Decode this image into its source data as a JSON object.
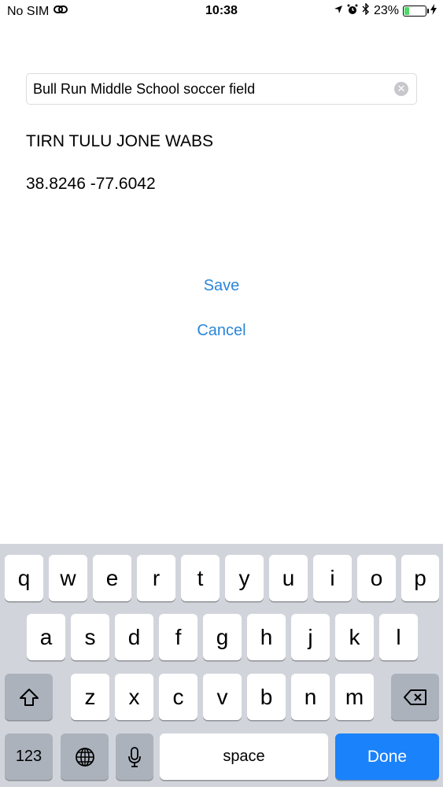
{
  "status_bar": {
    "carrier": "No SIM",
    "time": "10:38",
    "battery_percent": "23%",
    "battery_level": 0.23,
    "icons": [
      "link-icon",
      "location-icon",
      "alarm-icon",
      "bluetooth-icon",
      "battery-icon",
      "charging-icon"
    ]
  },
  "search": {
    "value": "Bull Run Middle School soccer field"
  },
  "result": {
    "place_name": "TIRN TULU JONE WABS",
    "coordinates": "38.8246 -77.6042"
  },
  "actions": {
    "save_label": "Save",
    "cancel_label": "Cancel"
  },
  "colors": {
    "link": "#2b86d8",
    "done_key": "#1a82fb",
    "keyboard_bg": "#d1d5db"
  },
  "keyboard": {
    "row1": [
      "q",
      "w",
      "e",
      "r",
      "t",
      "y",
      "u",
      "i",
      "o",
      "p"
    ],
    "row2": [
      "a",
      "s",
      "d",
      "f",
      "g",
      "h",
      "j",
      "k",
      "l"
    ],
    "row3": [
      "z",
      "x",
      "c",
      "v",
      "b",
      "n",
      "m"
    ],
    "numbers_label": "123",
    "space_label": "space",
    "done_label": "Done"
  }
}
